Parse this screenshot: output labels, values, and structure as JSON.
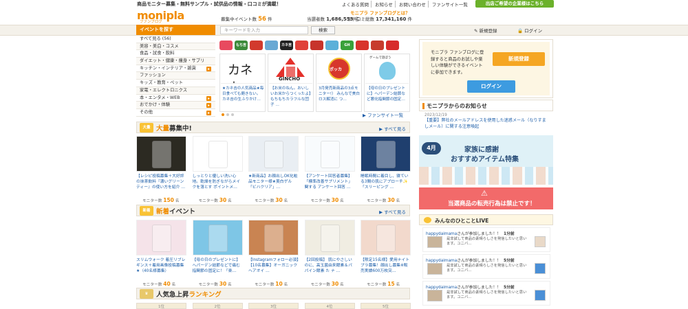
{
  "header": {
    "tagline": "商品モニター募集・無料サンプル・試供品の情報・口コミが満載！",
    "toplinks": [
      "よくある質問",
      "お知らせ",
      "お問い合わせ",
      "ファンサイト一覧"
    ],
    "corp_button": "出店ご希望の企業様はこちら",
    "logo": "monipla",
    "logo_sub": "ファンブログ",
    "about": "モニプラ ファンブログとは？",
    "stats": {
      "event_label": "募集中イベント数",
      "event_value": "56",
      "event_unit": "件",
      "winner_label": "当選者数",
      "winner_value": "1,686,553",
      "winner_unit": "名",
      "kuchikomi_label": "クチコミ総数",
      "kuchikomi_value": "17,341,160",
      "kuchikomi_unit": "件"
    }
  },
  "nav": {
    "event_tab": "イベントを探す",
    "search_placeholder": "キーワードを入力",
    "search_button": "検索",
    "register": "新規登録",
    "login": "ログイン"
  },
  "sidebar": {
    "categories": [
      {
        "label": "すべて見る (56)",
        "plus": false
      },
      {
        "label": "美容・美白・コスメ",
        "plus": false
      },
      {
        "label": "食品・試食・飲料",
        "plus": false
      },
      {
        "label": "ダイエット・健康・痩身・サプリ",
        "plus": false
      },
      {
        "label": "キッチン・インテリア・雑貨",
        "plus": true
      },
      {
        "label": "ファッション",
        "plus": false
      },
      {
        "label": "キッズ・教育・ペット",
        "plus": false
      },
      {
        "label": "家電・エレクトロニクス",
        "plus": false
      },
      {
        "label": "本・エンタメ・WEB",
        "plus": true
      },
      {
        "label": "おでかけ・体験",
        "plus": true
      },
      {
        "label": "その他",
        "plus": true
      }
    ]
  },
  "fansites": {
    "brands": [
      {
        "label": "",
        "color": "#e84a5f"
      },
      {
        "label": "もち吉",
        "color": "#3c8a3a"
      },
      {
        "label": "",
        "color": "#d23a2d"
      },
      {
        "label": "",
        "color": "#6aa9d4"
      },
      {
        "label": "カネ吉",
        "color": "#222222"
      },
      {
        "label": "",
        "color": "#e0413a"
      },
      {
        "label": "",
        "color": "#c7342b"
      },
      {
        "label": "",
        "color": "#5bb0d9"
      },
      {
        "label": "GH",
        "color": "#3aa13a"
      },
      {
        "label": "",
        "color": "#d8342c"
      },
      {
        "label": "",
        "color": "#c73b2d"
      },
      {
        "label": "",
        "color": "#d72c2c"
      }
    ],
    "cards": [
      {
        "img_text": "カネ吉",
        "desc": "★カネ吉の人気商品★毎日食べても飽きない。カネ吉の生ふりかけ…"
      },
      {
        "img_text": "GINCHO",
        "desc": "【お米のねん。おいしいお米からつくったよ】もちもちカラフルな団子 …"
      },
      {
        "img_text": "ポッカ",
        "desc": "3月発売新商品の3点モニター!） みんなで美白ロス解消に つ…"
      },
      {
        "img_text": "ゲームで遊ぼう",
        "desc": "【母の日のプレゼントに】ヘパーデン結節など悪化指関節の固定…"
      }
    ],
    "more": "ファンサイト一覧"
  },
  "section_tairyou": {
    "badge": "大量",
    "title_hl": "大量",
    "title_rest": "募集中!",
    "more": "すべて見る",
    "products": [
      {
        "desc": "【レシピ投稿募集＋大好評の抹茶飲料『濃いグリーンティー』の使い方を紹介 …",
        "monitor": "150"
      },
      {
        "desc": "しっとりと優しい洗い心地。乾燥を防ぎながらメイクを落とす ポイントメ…",
        "monitor": "30"
      },
      {
        "desc": "★新商品】お顔出しOK化粧品モニター様★美白ゲル「ビハクリア」…",
        "monitor": "30"
      },
      {
        "desc": "【アンケート回答者募集】「標準改善サプリメント」関する アンケート回答 …",
        "monitor": "30"
      },
      {
        "desc": "睡眠時間に着目し、寝ている3間の肌にアプローチ✨「スリーピング …",
        "monitor": "30"
      }
    ]
  },
  "section_new": {
    "badge": "新着",
    "title_hl": "新着",
    "title_rest": "イベント",
    "more": "すべて見る",
    "products": [
      {
        "desc": "スリムウォーク 着圧リブレギンス＋着用画像投稿募集★（40名様募集）",
        "monitor": "40"
      },
      {
        "desc": "【母の日のプレゼントに】ヘパーデン結節などで痛む指関節の固定に！「楽…",
        "monitor": "30"
      },
      {
        "desc": "【Instagramフォロー必須】【10名募集】オーガニックヘアオイ …",
        "monitor": "10"
      },
      {
        "desc": "【2回投稿】 肌にやさしいのに、高玉菌由来酵素＆パパイン酵素 た ナ …",
        "monitor": "30"
      },
      {
        "desc": "【限定15名様】愛用ナイトブラ募集！顔出し募集※販売実績600万枚突…",
        "monitor": "15"
      }
    ]
  },
  "section_rank": {
    "title_rest": "人気急上昇",
    "title_hl": "ランキング",
    "tabs": [
      "1位",
      "2位",
      "3位",
      "4位",
      "5位"
    ]
  },
  "right": {
    "intro": "モニプラ ファンブログに登録すると商品のお試しや楽しい体験ができるイベントに参加できます。",
    "register_btn": "新規登録",
    "login_btn": "ログイン",
    "notice_title": "モニプラからのお知らせ",
    "notice_date": "2023/12/19",
    "notice_text": "【重要】弊社のメールアドレスを使用した迷惑メール（なりすましメール）に関する注意喚起",
    "banner1_title": "家族に感謝",
    "banner1_sub": "おすすめアイテム特集",
    "banner1_month": "4月",
    "banner2_text": "当選商品の転売行為は禁止です！",
    "live_title": "みんなのひとことLIVE",
    "live_items": [
      {
        "user": "happydaimama",
        "action": "さんが参加しました！！",
        "time": "1分前",
        "body": "是非試して商品の素晴らしさを発信したいと思います。ユニバ…"
      },
      {
        "user": "happydaimama",
        "action": "さんが参加しました！！",
        "time": "5分前",
        "body": "是非試して商品の素晴らしさを発信したいと思います。ユニバ…"
      },
      {
        "user": "happydaimama",
        "action": "さんが参加しました！！",
        "time": "5分前",
        "body": "是非試して商品の素晴らしさを発信したいと思います。ユニバ…"
      }
    ]
  },
  "monitor_label": "モニター数",
  "monitor_unit": "名"
}
